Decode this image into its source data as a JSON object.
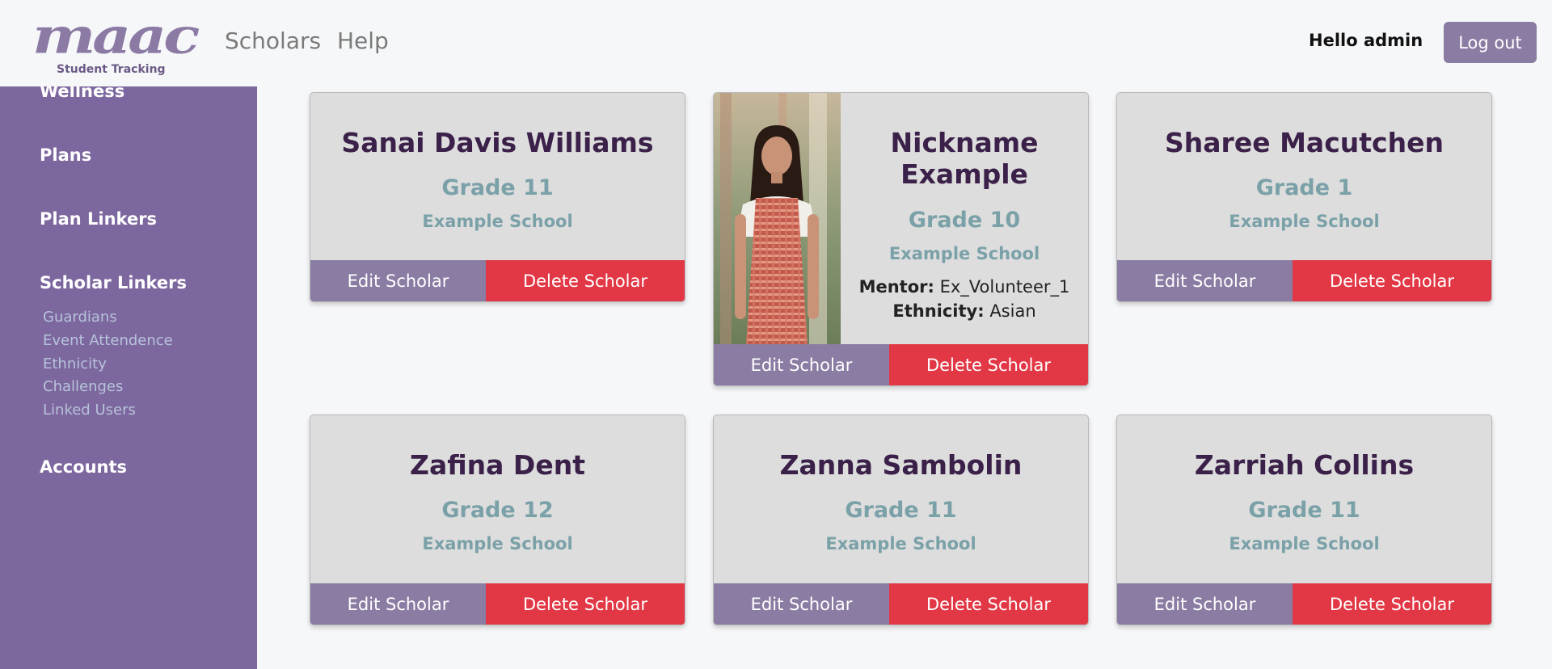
{
  "header": {
    "logo_text": "maac",
    "logo_subtitle": "Student Tracking",
    "nav": [
      "Scholars",
      "Help"
    ],
    "greeting": "Hello admin",
    "logout_label": "Log out"
  },
  "sidebar": {
    "sections": [
      {
        "label": "Wellness"
      },
      {
        "label": "Plans"
      },
      {
        "label": "Plan Linkers"
      },
      {
        "label": "Scholar Linkers",
        "items": [
          "Guardians",
          "Event Attendence",
          "Ethnicity",
          "Challenges",
          "Linked Users"
        ]
      },
      {
        "label": "Accounts"
      }
    ]
  },
  "cards": [
    {
      "name": "Sanai Davis Williams",
      "grade": "Grade 11",
      "school": "Example School"
    },
    {
      "name_lines": [
        "Nickname",
        "Example"
      ],
      "grade": "Grade 10",
      "school": "Example School",
      "mentor_label": "Mentor:",
      "mentor": "Ex_Volunteer_1",
      "ethnicity_label": "Ethnicity:",
      "ethnicity": "Asian"
    },
    {
      "name": "Sharee Macutchen",
      "grade": "Grade 1",
      "school": "Example School"
    },
    {
      "name": "Zafina Dent",
      "grade": "Grade 12",
      "school": "Example School"
    },
    {
      "name": "Zanna Sambolin",
      "grade": "Grade 11",
      "school": "Example School"
    },
    {
      "name": "Zarriah Collins",
      "grade": "Grade 11",
      "school": "Example School"
    }
  ],
  "actions": {
    "edit": "Edit Scholar",
    "delete": "Delete Scholar"
  },
  "colors": {
    "sidebar": "#7c679e",
    "edit_button": "#8a7ca2",
    "delete_button": "#e23745",
    "card_title": "#3b2149",
    "card_subtext": "#7ba1a8"
  }
}
